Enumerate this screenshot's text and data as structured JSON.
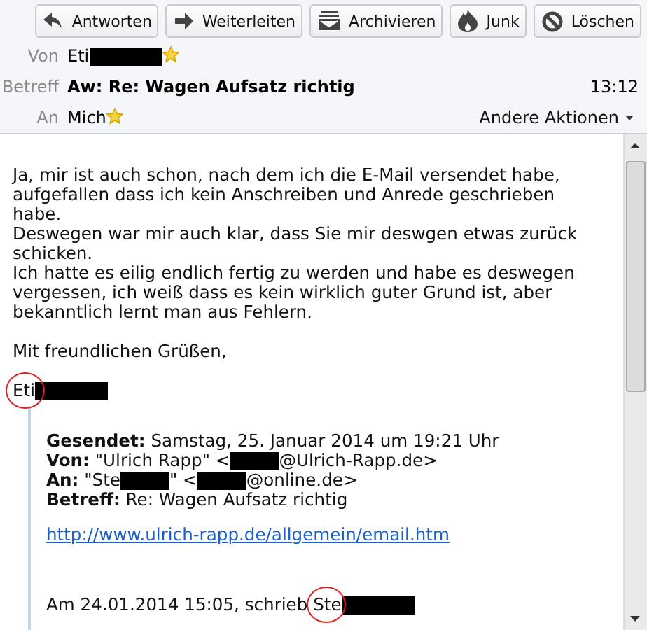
{
  "toolbar": [
    {
      "kind": "reply",
      "label": "Antworten"
    },
    {
      "kind": "forward",
      "label": "Weiterleiten"
    },
    {
      "kind": "archive",
      "label": "Archivieren"
    },
    {
      "kind": "junk",
      "label": "Junk"
    },
    {
      "kind": "delete",
      "label": "Löschen"
    }
  ],
  "header": {
    "from": {
      "label": "Von",
      "name": "Eti",
      "redacted": true,
      "starred": true
    },
    "subject": {
      "label": "Betreff",
      "value": "Aw: Re: Wagen Aufsatz richtig",
      "time": "13:12"
    },
    "to": {
      "label": "An",
      "name": "Mich",
      "redacted": false,
      "starred": true
    },
    "other_actions": "Andere Aktionen"
  },
  "body": {
    "paragraphs": [
      [
        "Ja, mir ist auch schon, nach dem ich die E-Mail versendet habe,",
        "aufgefallen dass ich kein Anschreiben und Anrede geschrieben",
        "habe.",
        "Deswegen war mir auch klar, dass Sie mir deswgen etwas zurück",
        "schicken.",
        "Ich hatte es eilig endlich fertig zu werden und habe es deswegen",
        "vergessen, ich weiß dass es kein wirklich guter Grund ist, aber",
        "bekanntlich lernt man aus Fehlern."
      ],
      [
        "Mit freundlichen Grüßen,"
      ]
    ]
  },
  "signature": [
    {
      "kind": "text",
      "text": "Eti",
      "circled": true
    },
    {
      "kind": "redaction"
    }
  ],
  "quote": {
    "fields": [
      {
        "label": "Gesendet:",
        "parts": [
          {
            "kind": "text",
            "text": "Samstag, 25. Januar 2014 um 19:21 Uhr"
          }
        ]
      },
      {
        "label": "Von:",
        "parts": [
          {
            "kind": "text",
            "text": "\"Ulrich Rapp\" <"
          },
          {
            "kind": "redaction"
          },
          {
            "kind": "text",
            "text": "@Ulrich-Rapp.de>"
          }
        ]
      },
      {
        "label": "An:",
        "parts": [
          {
            "kind": "text",
            "text": "\"Ste"
          },
          {
            "kind": "redaction"
          },
          {
            "kind": "text",
            "text": "\" <"
          },
          {
            "kind": "redaction"
          },
          {
            "kind": "text",
            "text": "@online.de>"
          }
        ]
      },
      {
        "label": "Betreff:",
        "parts": [
          {
            "kind": "text",
            "text": "Re: Wagen Aufsatz richtig"
          }
        ]
      }
    ],
    "link": "http://www.ulrich-rapp.de/allgemein/email.htm",
    "attribution": [
      {
        "kind": "text",
        "text": "Am 24.01.2014 15:05, schrieb "
      },
      {
        "kind": "text",
        "text": "Ste",
        "circled": true
      },
      {
        "kind": "redaction"
      }
    ]
  }
}
